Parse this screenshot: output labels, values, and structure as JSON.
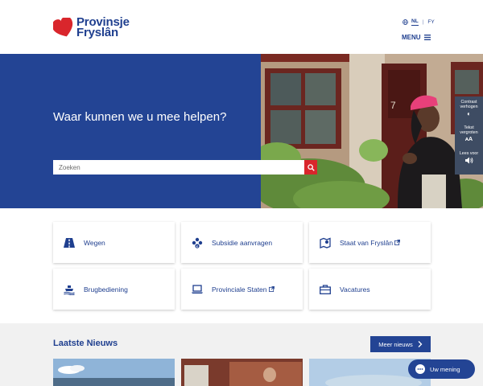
{
  "header": {
    "logo_line1": "Provinsje",
    "logo_line2": "Fryslân",
    "lang_nl": "NL",
    "lang_sep": "|",
    "lang_fy": "FY",
    "menu_label": "MENU"
  },
  "hero": {
    "title": "Waar kunnen we u mee helpen?",
    "search_placeholder": "Zoeken"
  },
  "accessibility": {
    "contrast_line1": "Contrast",
    "contrast_line2": "verhogen",
    "text_line1": "Tekst",
    "text_line2": "vergroten",
    "read_label": "Lees voor"
  },
  "tiles": [
    {
      "label": "Wegen",
      "icon": "road-icon"
    },
    {
      "label": "Subsidie aanvragen",
      "icon": "coins-icon"
    },
    {
      "label": "Staat van Fryslân",
      "icon": "map-icon",
      "external": true
    },
    {
      "label": "Brugbediening",
      "icon": "boat-icon"
    },
    {
      "label": "Provinciale Staten",
      "icon": "laptop-icon",
      "external": true
    },
    {
      "label": "Vacatures",
      "icon": "briefcase-icon"
    }
  ],
  "news": {
    "title": "Laatste Nieuws",
    "more_label": "Meer nieuws"
  },
  "chat": {
    "label": "Uw mening"
  },
  "colors": {
    "brand_blue": "#234494",
    "text_blue": "#1f3f8f",
    "accent_red": "#d9262c",
    "panel_gray": "#3e4c63"
  }
}
